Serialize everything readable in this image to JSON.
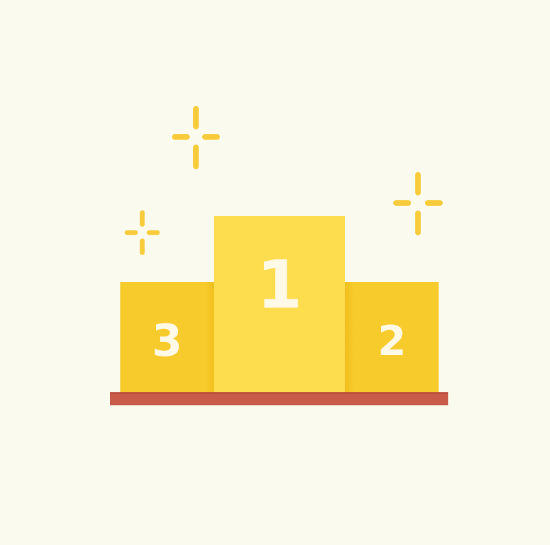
{
  "podium": {
    "first_place": "1",
    "second_place": "2",
    "third_place": "3"
  },
  "colors": {
    "background": "#FAFAEE",
    "first_block": "#FDDC4E",
    "side_blocks": "#F7CB2B",
    "base": "#C85A4A",
    "numbers": "#FFF9E8",
    "sparkles": "#F7CB3A"
  },
  "icons": [
    "sparkle-icon"
  ]
}
